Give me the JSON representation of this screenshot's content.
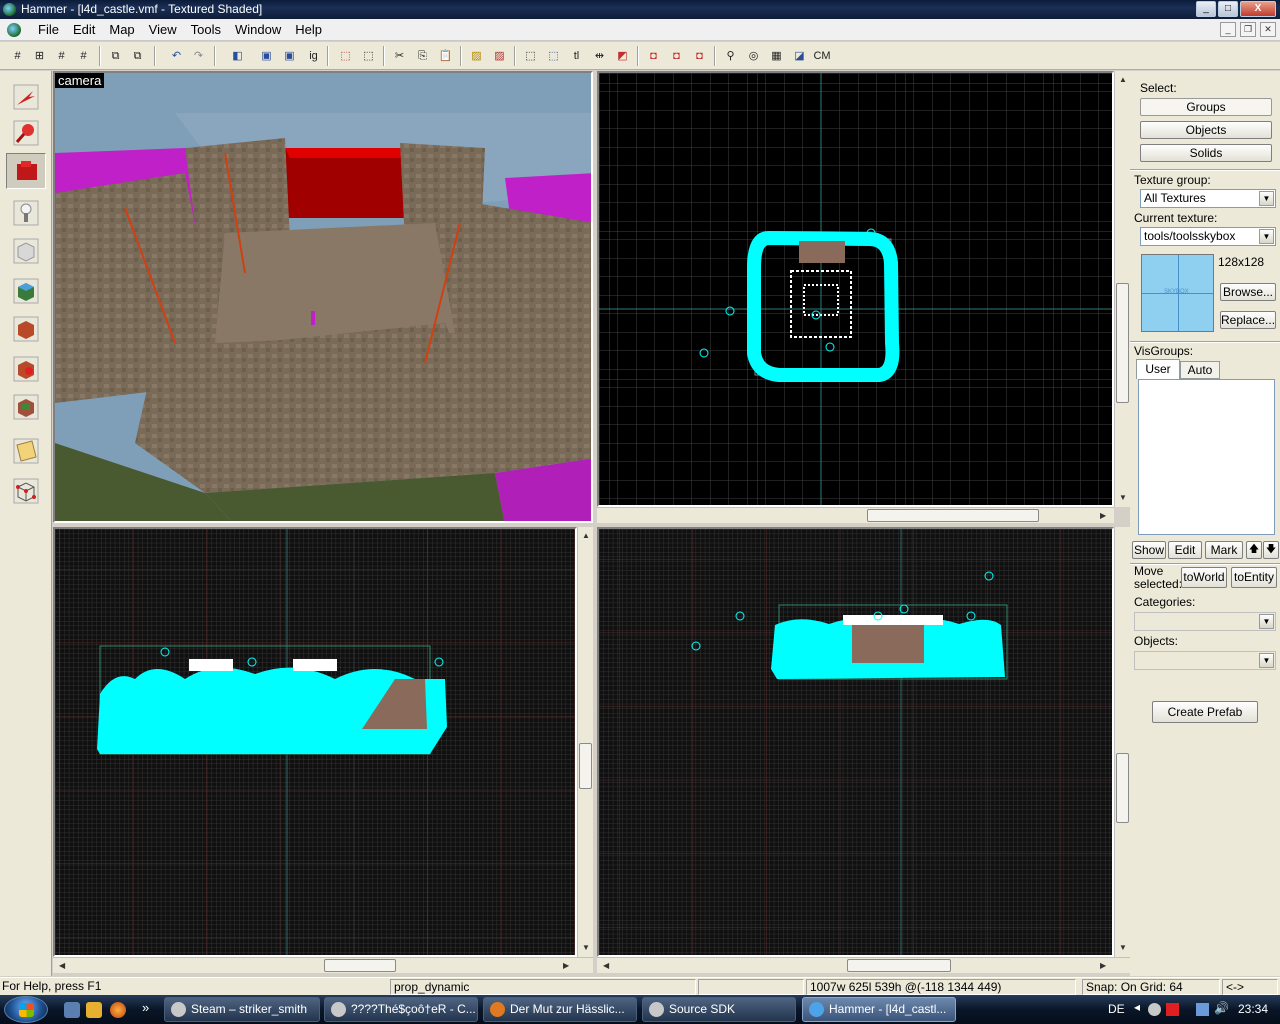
{
  "window": {
    "title": "Hammer - [l4d_castle.vmf - Textured Shaded]",
    "min": "_",
    "max": "□",
    "close": "X"
  },
  "menu": {
    "items": [
      "File",
      "Edit",
      "Map",
      "View",
      "Tools",
      "Window",
      "Help"
    ]
  },
  "toolbar": {
    "labels": {
      "ig": "ig",
      "tl": "tl",
      "cm": "CM"
    }
  },
  "viewports": {
    "camera_label": "camera"
  },
  "right_panel": {
    "select_label": "Select:",
    "groups": "Groups",
    "objects": "Objects",
    "solids": "Solids",
    "texture_group_label": "Texture group:",
    "texture_group_value": "All Textures",
    "current_texture_label": "Current texture:",
    "current_texture_value": "tools/toolsskybox",
    "texture_size": "128x128",
    "thumb_text": "SKYBOX",
    "browse": "Browse...",
    "replace": "Replace...",
    "visgroups_label": "VisGroups:",
    "tab_user": "User",
    "tab_auto": "Auto",
    "show": "Show",
    "edit": "Edit",
    "mark": "Mark",
    "up": "🡅",
    "down": "🡇",
    "move_selected_1": "Move",
    "move_selected_2": "selected:",
    "to_world": "toWorld",
    "to_entity": "toEntity",
    "categories_label": "Categories:",
    "objects_label": "Objects:",
    "create_prefab": "Create Prefab"
  },
  "status": {
    "help": "For Help, press F1",
    "entity": "prop_dynamic",
    "dims": "1007w 625l 539h @(-118 1344 449)",
    "snap": "Snap: On Grid: 64",
    "arrows": "<->"
  },
  "taskbar": {
    "tasks": [
      {
        "label": "Steam – striker_smith",
        "color": "#c8c8c8"
      },
      {
        "label": "????Thé$çoô†eR - C...",
        "color": "#c8c8c8"
      },
      {
        "label": "Der Mut zur Hässlic...",
        "color": "#e07a22"
      },
      {
        "label": "Source SDK",
        "color": "#c8c8c8"
      },
      {
        "label": "Hammer - [l4d_castl...",
        "color": "#4da3e8"
      }
    ],
    "lang": "DE",
    "time": "23:34",
    "more": "»"
  },
  "colors": {
    "selection": "#00ffff",
    "grid_major": "#7a2a2a",
    "grid_minor": "#3a3a3a"
  }
}
